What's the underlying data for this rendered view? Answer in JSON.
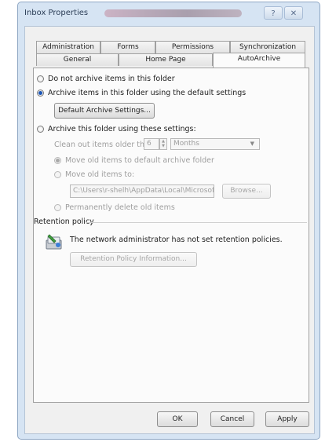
{
  "window": {
    "title": "Inbox Properties",
    "help_glyph": "?",
    "close_glyph": "✕"
  },
  "tabs_row1": [
    {
      "label": "Administration"
    },
    {
      "label": "Forms"
    },
    {
      "label": "Permissions"
    },
    {
      "label": "Synchronization"
    }
  ],
  "tabs_row2": [
    {
      "label": "General"
    },
    {
      "label": "Home Page"
    },
    {
      "label": "AutoArchive",
      "active": true
    }
  ],
  "autoarchive": {
    "opt_no_archive": "Do not archive items in this folder",
    "opt_default": "Archive items in this folder using the default settings",
    "default_settings_button": "Default Archive Settings...",
    "opt_custom": "Archive this folder using these settings:",
    "clean_label": "Clean out items older than",
    "clean_value": "6",
    "clean_unit": "Months",
    "move_default": "Move old items to default archive folder",
    "move_to": "Move old items to:",
    "path_value": "C:\\Users\\r-shelh\\AppData\\Local\\Microsoft",
    "browse_button": "Browse...",
    "delete_permanently": "Permanently delete old items"
  },
  "retention": {
    "heading": "Retention policy",
    "message": "The network administrator has not set retention policies.",
    "info_button": "Retention Policy Information..."
  },
  "footer": {
    "ok": "OK",
    "cancel": "Cancel",
    "apply": "Apply"
  }
}
